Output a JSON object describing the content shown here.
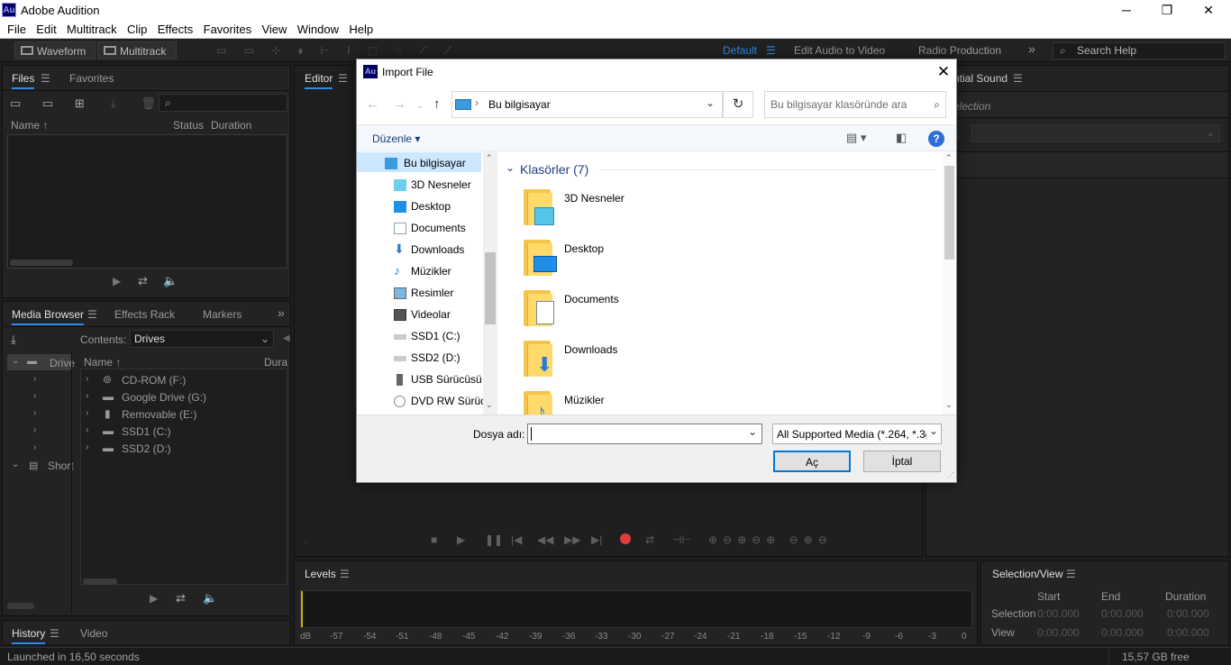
{
  "app": {
    "title": "Adobe Audition",
    "logo_text": "Au",
    "window_controls": [
      "─",
      "❐",
      "✕"
    ]
  },
  "menu": [
    "File",
    "Edit",
    "Multitrack",
    "Clip",
    "Effects",
    "Favorites",
    "View",
    "Window",
    "Help"
  ],
  "toolbar": {
    "waveform": "Waveform",
    "multitrack": "Multitrack",
    "workspaces": [
      "Default",
      "Edit Audio to Video",
      "Radio Production"
    ],
    "more": "»",
    "search_placeholder": "Search Help"
  },
  "files_panel": {
    "tabs": [
      "Files",
      "Favorites"
    ],
    "columns": [
      "Name ↑",
      "Status",
      "Duration"
    ]
  },
  "media_browser": {
    "tabs": [
      "Media Browser",
      "Effects Rack",
      "Markers"
    ],
    "more": "»",
    "contents_label": "Contents:",
    "contents_value": "Drives",
    "left_tree": [
      "Drive",
      "Short"
    ],
    "columns": [
      "Name ↑",
      "Dura"
    ],
    "drives": [
      "CD-ROM (F:)",
      "Google Drive (G:)",
      "Removable (E:)",
      "SSD1 (C:)",
      "SSD2 (D:)"
    ]
  },
  "editor_panel": {
    "tab": "Editor"
  },
  "essential_sound": {
    "title": "ntial Sound",
    "selection": "election",
    "label": "t:"
  },
  "dialog": {
    "title": "Import File",
    "logo_text": "Au",
    "breadcrumb": "Bu bilgisayar",
    "search_placeholder": "Bu bilgisayar klasöründe ara",
    "organize": "Düzenle",
    "help": "?",
    "tree": [
      "Bu bilgisayar",
      "3D Nesneler",
      "Desktop",
      "Documents",
      "Downloads",
      "Müzikler",
      "Resimler",
      "Videolar",
      "SSD1 (C:)",
      "SSD2 (D:)",
      "USB Sürücüsü (",
      "DVD RW Sürüc"
    ],
    "group_header": "Klasörler (7)",
    "folders": [
      "3D Nesneler",
      "Desktop",
      "Documents",
      "Downloads",
      "Müzikler"
    ],
    "filename_label": "Dosya adı:",
    "filename_value": "",
    "filetype": "All Supported Media (*.264, *.3g",
    "open_button": "Aç",
    "cancel_button": "İptal"
  },
  "levels": {
    "title": "Levels",
    "scale": [
      "dB",
      "-57",
      "-54",
      "-51",
      "-48",
      "-45",
      "-42",
      "-39",
      "-36",
      "-33",
      "-30",
      "-27",
      "-24",
      "-21",
      "-18",
      "-15",
      "-12",
      "-9",
      "-6",
      "-3",
      "0"
    ]
  },
  "selection_view": {
    "title": "Selection/View",
    "columns": [
      "Start",
      "End",
      "Duration"
    ],
    "rows": [
      {
        "label": "Selection",
        "start": "0:00.000",
        "end": "0:00.000",
        "duration": "0:00.000"
      },
      {
        "label": "View",
        "start": "0:00.000",
        "end": "0:00.000",
        "duration": "0:00.000"
      }
    ]
  },
  "history_panel": {
    "tabs": [
      "History",
      "Video"
    ]
  },
  "status": {
    "left": "Launched in 16,50 seconds",
    "right": "15,57 GB free"
  },
  "colors": {
    "accent": "#2d8ceb",
    "record": "#e23b3b",
    "brand": "#00005b"
  }
}
